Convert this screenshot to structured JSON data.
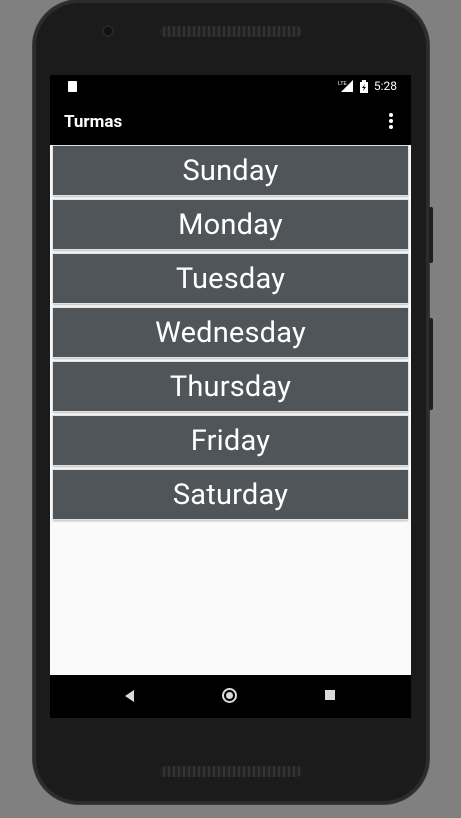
{
  "status_bar": {
    "time": "5:28",
    "network_label": "LTE"
  },
  "app_bar": {
    "title": "Turmas"
  },
  "days": [
    "Sunday",
    "Monday",
    "Tuesday",
    "Wednesday",
    "Thursday",
    "Friday",
    "Saturday"
  ],
  "colors": {
    "button_bg": "#50555a",
    "app_bar": "#000000",
    "screen_bg": "#fafafa"
  }
}
